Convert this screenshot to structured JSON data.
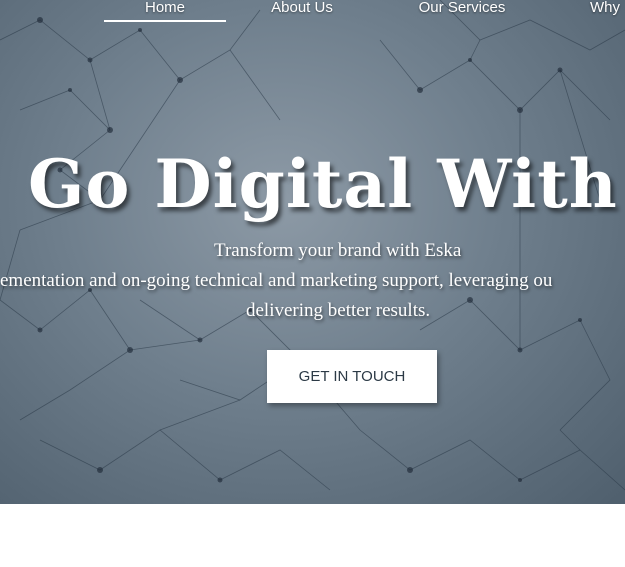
{
  "nav": {
    "items": [
      {
        "label": "Home",
        "active": true
      },
      {
        "label": "About Us",
        "active": false
      },
      {
        "label": "Our Services",
        "active": false
      },
      {
        "label": "Why",
        "active": false
      }
    ]
  },
  "hero": {
    "headline": "Go Digital With U",
    "tagline": "Transform your brand with Eska",
    "description_line1": "ementation and on-going technical and marketing support, leveraging ou",
    "description_line2": "delivering better results.",
    "cta_label": "GET IN TOUCH"
  },
  "colors": {
    "hero_background": "#6f7f8d",
    "text": "#ffffff",
    "button_background": "#ffffff",
    "button_text": "#2c3a46"
  }
}
